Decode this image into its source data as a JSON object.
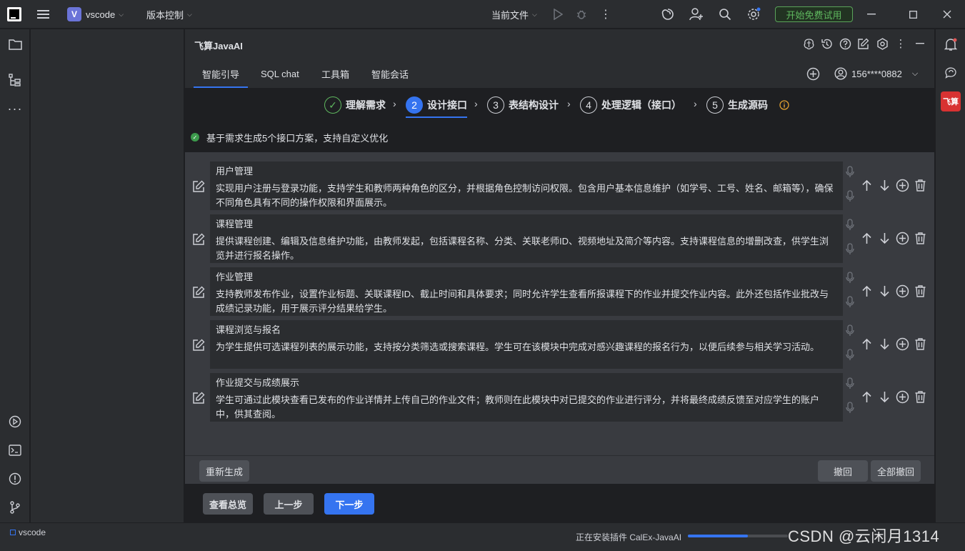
{
  "titlebar": {
    "project_badge": "V",
    "project_name": "vscode",
    "vcs_label": "版本控制",
    "run_config": "当前文件",
    "try_free": "开始免费试用"
  },
  "plugin": {
    "title": "飞算JavaAI",
    "tabs": [
      "智能引导",
      "SQL chat",
      "工具箱",
      "智能会话"
    ],
    "user": "156****0882",
    "steps": [
      {
        "num": "✓",
        "label": "理解需求"
      },
      {
        "num": "2",
        "label": "设计接口"
      },
      {
        "num": "3",
        "label": "表结构设计"
      },
      {
        "num": "4",
        "label": "处理逻辑（接口）"
      },
      {
        "num": "5",
        "label": "生成源码"
      }
    ],
    "summary": "基于需求生成5个接口方案，支持自定义优化",
    "items": [
      {
        "title": "用户管理",
        "desc": "实现用户注册与登录功能，支持学生和教师两种角色的区分，并根据角色控制访问权限。包含用户基本信息维护（如学号、工号、姓名、邮箱等），确保不同角色具有不同的操作权限和界面展示。"
      },
      {
        "title": "课程管理",
        "desc": "提供课程创建、编辑及信息维护功能，由教师发起，包括课程名称、分类、关联老师ID、视频地址及简介等内容。支持课程信息的增删改查，供学生浏览并进行报名操作。"
      },
      {
        "title": "作业管理",
        "desc": "支持教师发布作业，设置作业标题、关联课程ID、截止时间和具体要求；同时允许学生查看所报课程下的作业并提交作业内容。此外还包括作业批改与成绩记录功能，用于展示评分结果给学生。"
      },
      {
        "title": "课程浏览与报名",
        "desc": "为学生提供可选课程列表的展示功能，支持按分类筛选或搜索课程。学生可在该模块中完成对感兴趣课程的报名行为，以便后续参与相关学习活动。"
      },
      {
        "title": "作业提交与成绩展示",
        "desc": "学生可通过此模块查看已发布的作业详情并上传自己的作业文件；教师则在此模块中对已提交的作业进行评分，并将最终成绩反馈至对应学生的账户中，供其查阅。"
      }
    ],
    "regenerate": "重新生成",
    "undo": "撤回",
    "undo_all": "全部撤回",
    "overview": "查看总览",
    "prev": "上一步",
    "next": "下一步"
  },
  "statusbar": {
    "project": "vscode",
    "installing": "正在安装插件 CalEx-JavaAI",
    "progress": 0.6,
    "watermark": "CSDN @云闲月1314"
  },
  "colors": {
    "accent": "#3574f0",
    "success": "#5fb85f",
    "brand_red": "#d83232"
  }
}
